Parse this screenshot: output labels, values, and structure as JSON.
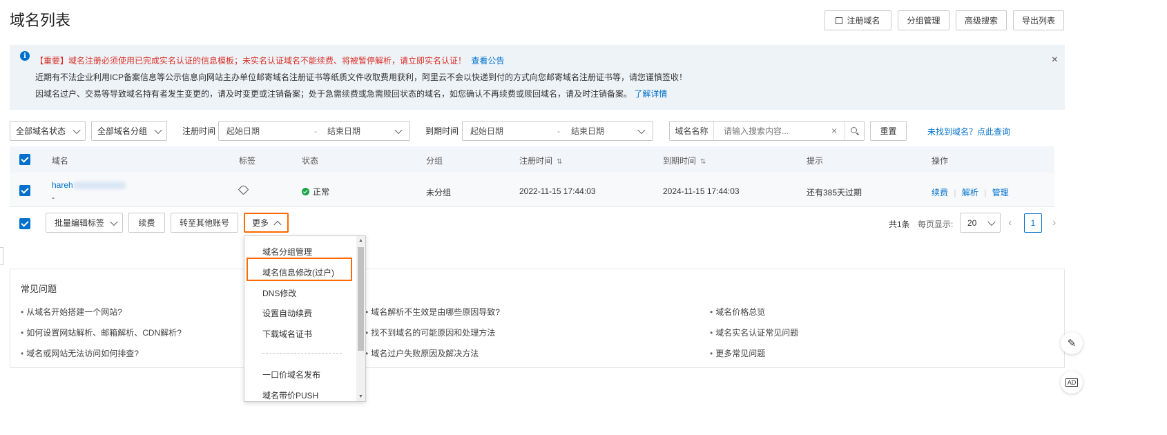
{
  "page": {
    "title": "域名列表"
  },
  "header_buttons": {
    "register": "注册域名",
    "group": "分组管理",
    "advanced": "高级搜索",
    "export": "导出列表"
  },
  "notice": {
    "line1_red": "【重要】域名注册必须使用已完成实名认证的信息模板；未实名认证域名不能续费、将被暂停解析，请立即实名认证！",
    "line1_link": "查看公告",
    "line2": "近期有不法企业利用ICP备案信息等公示信息向网站主办单位邮寄域名注册证书等纸质文件收取费用获利，阿里云不会以快递到付的方式向您邮寄域名注册证书等，请您谨慎签收！",
    "line3": "因域名过户、交易等导致域名持有者发生变更的，请及时变更或注销备案；处于急需续费或急需赎回状态的域名，如您确认不再续费或赎回域名，请及时注销备案。",
    "line3_link": "了解详情"
  },
  "filters": {
    "status": "全部域名状态",
    "group": "全部域名分组",
    "reg_label": "注册时间",
    "exp_label": "到期时间",
    "start_placeholder": "起始日期",
    "end_placeholder": "结束日期",
    "dash": "-",
    "search_label": "域名名称",
    "search_placeholder": "请输入搜索内容...",
    "reset": "重置",
    "not_found": "未找到域名？点此查询"
  },
  "table": {
    "headers": {
      "domain": "域名",
      "tag": "标签",
      "status": "状态",
      "group": "分组",
      "reg": "注册时间",
      "exp": "到期时间",
      "tip": "提示",
      "ops": "操作"
    },
    "row": {
      "domain": "hareh",
      "domain_sub": "-",
      "status": "正常",
      "group": "未分组",
      "reg": "2022-11-15 17:44:03",
      "exp": "2024-11-15 17:44:03",
      "tip": "还有385天过期",
      "op_renew": "续费",
      "op_resolve": "解析",
      "op_manage": "管理"
    }
  },
  "bulk": {
    "edit_tags": "批量编辑标签",
    "renew": "续费",
    "transfer": "转至其他账号",
    "more": "更多"
  },
  "pagination": {
    "total": "共1条",
    "per_page_label": "每页显示:",
    "per_page": "20",
    "current": "1"
  },
  "dropdown": {
    "items": [
      "域名分组管理",
      "域名信息修改(过户)",
      "DNS修改",
      "设置自动续费",
      "下载域名证书",
      "一口价域名发布",
      "域名带价PUSH"
    ]
  },
  "faq": {
    "title": "常见问题",
    "col1": [
      "从域名开始搭建一个网站?",
      "如何设置网站解析、邮箱解析、CDN解析?",
      "域名或网站无法访问如何排查?"
    ],
    "col2": [
      "域名解析不生效是由哪些原因导致?",
      "找不到域名的可能原因和处理方法",
      "域名过户失败原因及解决方法"
    ],
    "col3": [
      "域名价格总览",
      "域名实名认证常见问题",
      "更多常见问题"
    ]
  },
  "side": {
    "ad": "AD"
  },
  "colors": {
    "accent": "#0070cc",
    "highlight": "#ff6a00",
    "success": "#1aa64a",
    "notice_bg": "#eef3f8",
    "red": "#d93026"
  }
}
